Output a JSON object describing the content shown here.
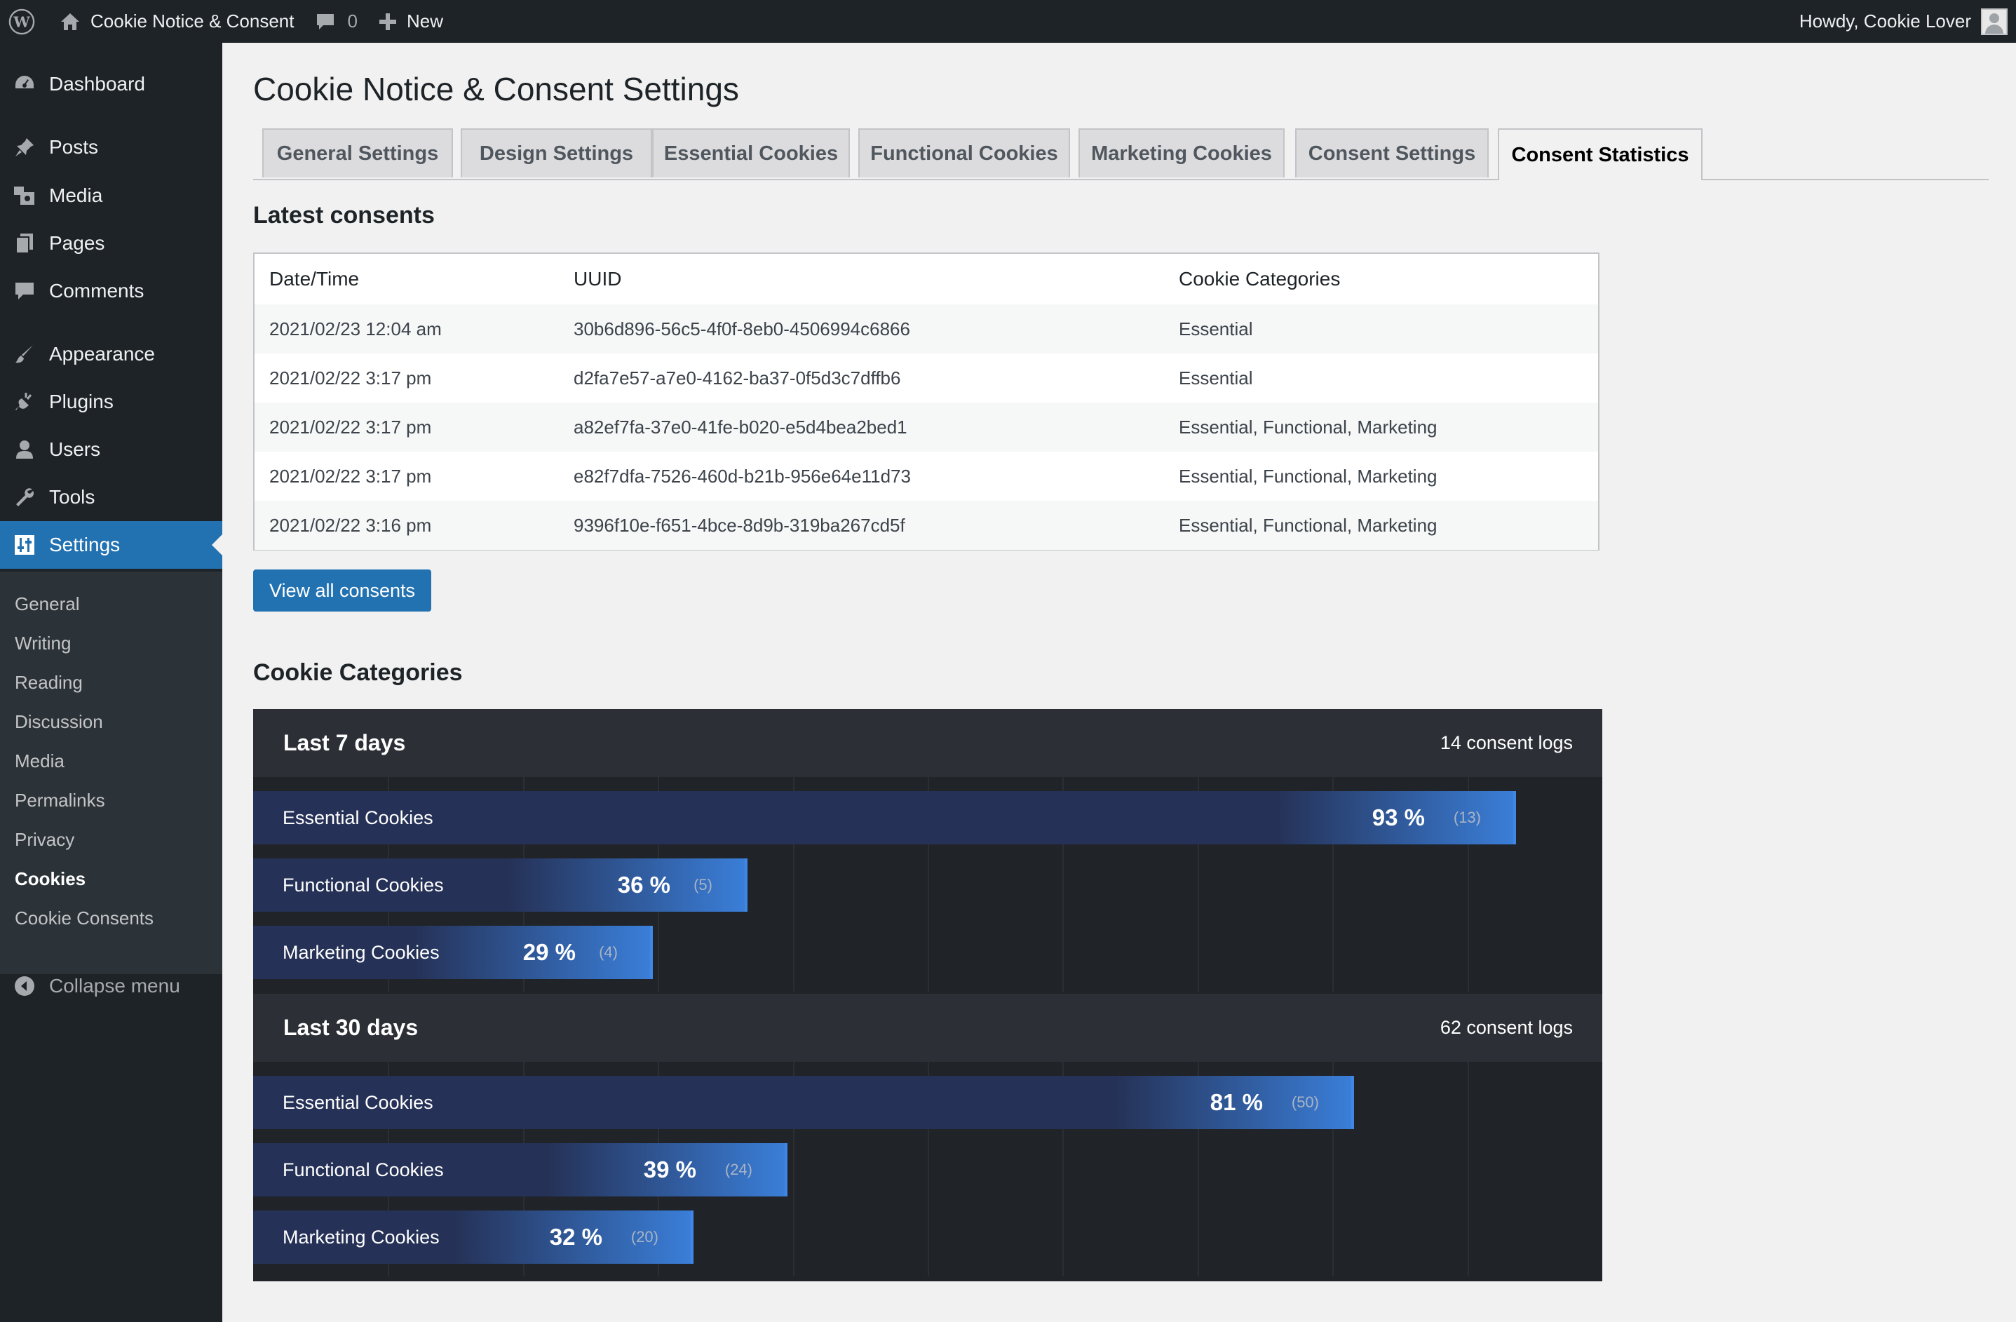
{
  "adminbar": {
    "site_name": "Cookie Notice & Consent",
    "comments_count": "0",
    "new_label": "New",
    "howdy": "Howdy, Cookie Lover"
  },
  "sidebar": {
    "items": [
      {
        "label": "Dashboard",
        "icon": "dashboard-icon"
      },
      {
        "label": "Posts",
        "icon": "pin-icon"
      },
      {
        "label": "Media",
        "icon": "media-icon"
      },
      {
        "label": "Pages",
        "icon": "pages-icon"
      },
      {
        "label": "Comments",
        "icon": "comment-icon"
      },
      {
        "label": "Appearance",
        "icon": "brush-icon"
      },
      {
        "label": "Plugins",
        "icon": "plug-icon"
      },
      {
        "label": "Users",
        "icon": "user-icon"
      },
      {
        "label": "Tools",
        "icon": "wrench-icon"
      },
      {
        "label": "Settings",
        "icon": "settings-icon"
      }
    ],
    "submenu": [
      "General",
      "Writing",
      "Reading",
      "Discussion",
      "Media",
      "Permalinks",
      "Privacy",
      "Cookies",
      "Cookie Consents"
    ],
    "submenu_current": "Cookies",
    "collapse_label": "Collapse menu"
  },
  "page": {
    "title": "Cookie Notice & Consent Settings",
    "tabs": [
      "General Settings",
      "Design Settings",
      "Essential Cookies",
      "Functional Cookies",
      "Marketing Cookies",
      "Consent Settings",
      "Consent Statistics"
    ],
    "active_tab": "Consent Statistics"
  },
  "latest": {
    "heading": "Latest consents",
    "columns": [
      "Date/Time",
      "UUID",
      "Cookie Categories"
    ],
    "rows": [
      [
        "2021/02/23 12:04 am",
        "30b6d896-56c5-4f0f-8eb0-4506994c6866",
        "Essential"
      ],
      [
        "2021/02/22 3:17 pm",
        "d2fa7e57-a7e0-4162-ba37-0f5d3c7dffb6",
        "Essential"
      ],
      [
        "2021/02/22 3:17 pm",
        "a82ef7fa-37e0-41fe-b020-e5d4bea2bed1",
        "Essential, Functional, Marketing"
      ],
      [
        "2021/02/22 3:17 pm",
        "e82f7dfa-7526-460d-b21b-956e64e11d73",
        "Essential, Functional, Marketing"
      ],
      [
        "2021/02/22 3:16 pm",
        "9396f10e-f651-4bce-8d9b-319ba267cd5f",
        "Essential, Functional, Marketing"
      ]
    ],
    "button_label": "View all consents"
  },
  "categories": {
    "heading": "Cookie Categories",
    "periods": [
      {
        "title": "Last 7 days",
        "logs": "14 consent logs",
        "bars": [
          {
            "label": "Essential Cookies",
            "pct_text": "93 %",
            "count_text": "(13)",
            "pct": 93
          },
          {
            "label": "Functional Cookies",
            "pct_text": "36 %",
            "count_text": "(5)",
            "pct": 36
          },
          {
            "label": "Marketing Cookies",
            "pct_text": "29 %",
            "count_text": "(4)",
            "pct": 29
          }
        ]
      },
      {
        "title": "Last 30 days",
        "logs": "62 consent logs",
        "bars": [
          {
            "label": "Essential Cookies",
            "pct_text": "81 %",
            "count_text": "(50)",
            "pct": 81
          },
          {
            "label": "Functional Cookies",
            "pct_text": "39 %",
            "count_text": "(24)",
            "pct": 39
          },
          {
            "label": "Marketing Cookies",
            "pct_text": "32 %",
            "count_text": "(20)",
            "pct": 32
          }
        ]
      }
    ]
  },
  "colors": {
    "sidebar_bg": "#1d2327",
    "accent": "#2271b1",
    "stats_bg": "#202328",
    "bar_dark": "#253156",
    "bar_light": "#3a7ed8"
  }
}
